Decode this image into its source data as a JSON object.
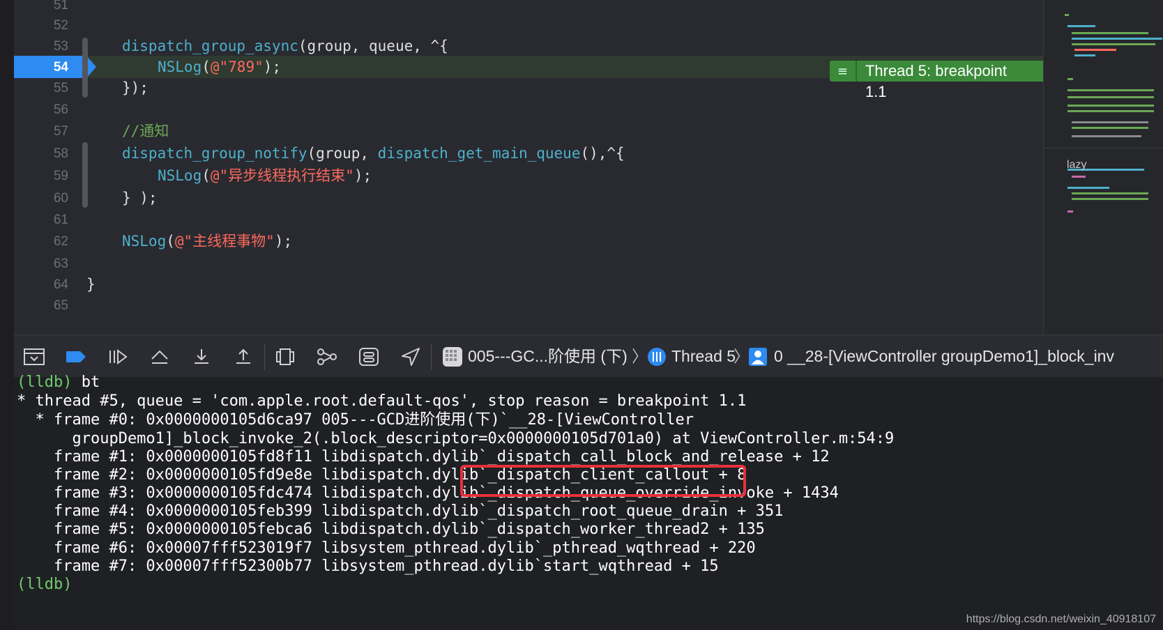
{
  "editor": {
    "lines": [
      {
        "no": "51",
        "code": ""
      },
      {
        "no": "52",
        "code": ""
      },
      {
        "no": "53",
        "code": ""
      },
      {
        "no": "54",
        "code": ""
      },
      {
        "no": "55",
        "code": ""
      },
      {
        "no": "56",
        "code": ""
      },
      {
        "no": "57",
        "code": ""
      },
      {
        "no": "58",
        "code": ""
      },
      {
        "no": "59",
        "code": ""
      },
      {
        "no": "60",
        "code": ""
      },
      {
        "no": "61",
        "code": ""
      },
      {
        "no": "62",
        "code": ""
      },
      {
        "no": "63",
        "code": ""
      },
      {
        "no": "64",
        "code": ""
      },
      {
        "no": "65",
        "code": ""
      }
    ],
    "code": {
      "l53_fn": "dispatch_group_async",
      "l53_rest": "(group, queue, ^{",
      "l54_fn": "NSLog",
      "l54_open": "(",
      "l54_str": "@\"789\"",
      "l54_close": ");",
      "l55": "});",
      "l57_comment": "//通知",
      "l58_fn": "dispatch_group_notify",
      "l58_mid": "(group, ",
      "l58_fn2": "dispatch_get_main_queue",
      "l58_end": "(),^{",
      "l59_fn": "NSLog",
      "l59_open": "(",
      "l59_str": "@\"异步线程执行结束\"",
      "l59_close": ");",
      "l60": "} );",
      "l62_fn": "NSLog",
      "l62_open": "(",
      "l62_str": "@\"主线程事物\"",
      "l62_close": ");",
      "l64": "}"
    },
    "current_line": "54",
    "breakpoint_badge": "Thread 5: breakpoint 1.1",
    "breakpoint_icon": "≡"
  },
  "minimap": {
    "label": "lazy"
  },
  "debug_bar": {
    "breadcrumb_project": "005---GC...阶使用 (下)",
    "breadcrumb_thread": "Thread 5",
    "breadcrumb_frame": "0 __28-[ViewController groupDemo1]_block_inv",
    "sep": "〉"
  },
  "console": {
    "lines": [
      {
        "prompt": "(lldb)",
        "text": " bt"
      },
      {
        "prompt": "",
        "text": "* thread #5, queue = 'com.apple.root.default-qos', stop reason = breakpoint 1.1"
      },
      {
        "prompt": "",
        "text": "  * frame #0: 0x0000000105d6ca97 005---GCD进阶使用(下)`__28-[ViewController"
      },
      {
        "prompt": "",
        "text": "      groupDemo1]_block_invoke_2(.block_descriptor=0x0000000105d701a0) at ViewController.m:54:9"
      },
      {
        "prompt": "",
        "text": "    frame #1: 0x0000000105fd8f11 libdispatch.dylib`_dispatch_call_block_and_release + 12"
      },
      {
        "prompt": "",
        "text": "    frame #2: 0x0000000105fd9e8e libdispatch.dylib`_dispatch_client_callout + 8"
      },
      {
        "prompt": "",
        "text": "    frame #3: 0x0000000105fdc474 libdispatch.dylib`_dispatch_queue_override_invoke + 1434"
      },
      {
        "prompt": "",
        "text": "    frame #4: 0x0000000105feb399 libdispatch.dylib`_dispatch_root_queue_drain + 351"
      },
      {
        "prompt": "",
        "text": "    frame #5: 0x0000000105febca6 libdispatch.dylib`_dispatch_worker_thread2 + 135"
      },
      {
        "prompt": "",
        "text": "    frame #6: 0x00007fff523019f7 libsystem_pthread.dylib`_pthread_wqthread + 220"
      },
      {
        "prompt": "",
        "text": "    frame #7: 0x00007fff52300b77 libsystem_pthread.dylib`start_wqthread + 15"
      },
      {
        "prompt": "(lldb)",
        "text": ""
      }
    ]
  },
  "watermark": "https://blog.csdn.net/weixin_40918107",
  "colors": {
    "background": "#292a30",
    "accent_blue": "#2d8bf1",
    "breakpoint_green": "#3b8a3a",
    "highlight_red": "#e8303c",
    "prompt_green": "#6fcc6a"
  }
}
